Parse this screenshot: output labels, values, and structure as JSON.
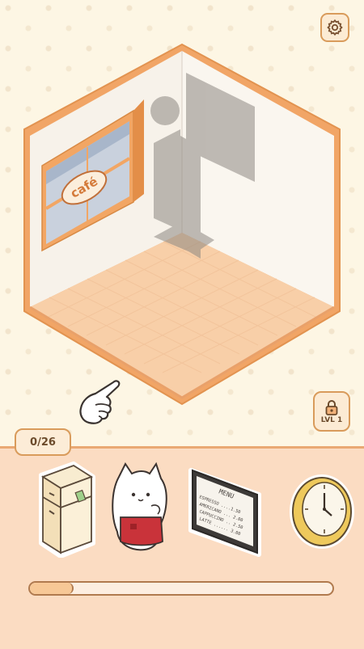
{
  "hud": {
    "settings_icon": "gear-icon",
    "level_label": "LVL 1",
    "level_icon": "lock-icon"
  },
  "room": {
    "window_sign": "café"
  },
  "inventory": {
    "counter": "0/26",
    "progress": 0.14,
    "items": [
      {
        "name": "fridge"
      },
      {
        "name": "cat-waiter"
      },
      {
        "name": "menu-board"
      },
      {
        "name": "wall-clock"
      }
    ],
    "menu_board": {
      "title": "MENU",
      "lines": [
        "ESPRESSO ....1.50",
        "AMERICANO ... 2.00",
        "CAPPUCCINO .. 2.50",
        "LATTE ...... 3.00"
      ]
    }
  }
}
